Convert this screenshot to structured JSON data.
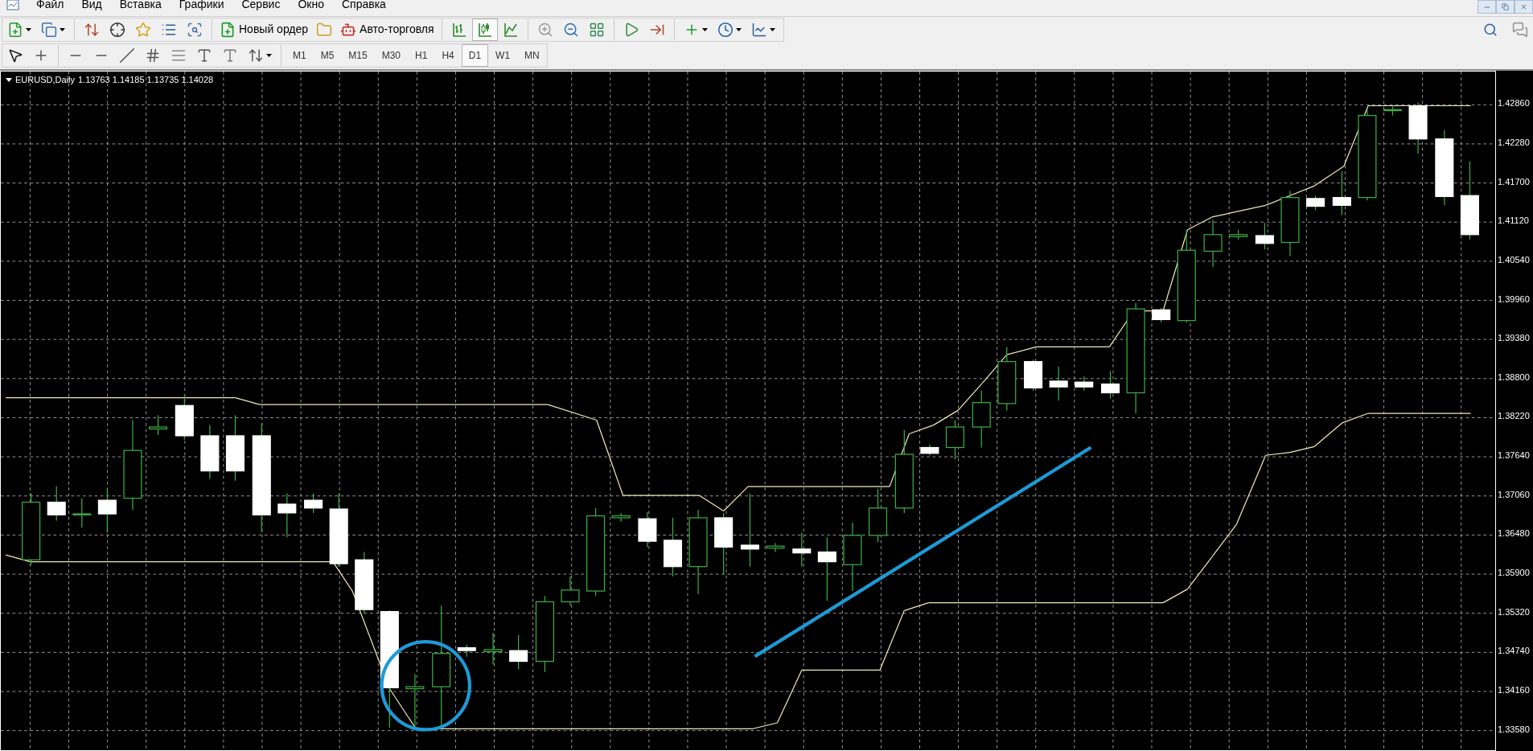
{
  "menu": [
    {
      "label": "Файл"
    },
    {
      "label": "Вид"
    },
    {
      "label": "Вставка"
    },
    {
      "label": "Графики"
    },
    {
      "label": "Сервис"
    },
    {
      "label": "Окно"
    },
    {
      "label": "Справка"
    }
  ],
  "toolbar": {
    "new_order": "Новый ордер",
    "auto_trading": "Авто-торговля",
    "chart_types": [
      {
        "selected": false
      },
      {
        "selected": true
      },
      {
        "selected": false
      }
    ]
  },
  "timeframes": [
    {
      "label": "M1",
      "selected": false
    },
    {
      "label": "M5",
      "selected": false
    },
    {
      "label": "M15",
      "selected": false
    },
    {
      "label": "M30",
      "selected": false
    },
    {
      "label": "H1",
      "selected": false
    },
    {
      "label": "H4",
      "selected": false
    },
    {
      "label": "D1",
      "selected": true
    },
    {
      "label": "W1",
      "selected": false
    },
    {
      "label": "MN",
      "selected": false
    }
  ],
  "chart": {
    "symbol": "EURUSD,Daily",
    "quote": "1.13763 1.14185 1.13735 1.14028",
    "price_axis": [
      "1.42860",
      "1.42280",
      "1.41700",
      "1.41120",
      "1.40540",
      "1.39960",
      "1.39380",
      "1.38800",
      "1.38220",
      "1.37640",
      "1.37060",
      "1.36480",
      "1.35900",
      "1.35320",
      "1.34740",
      "1.34160",
      "1.33580"
    ]
  }
}
